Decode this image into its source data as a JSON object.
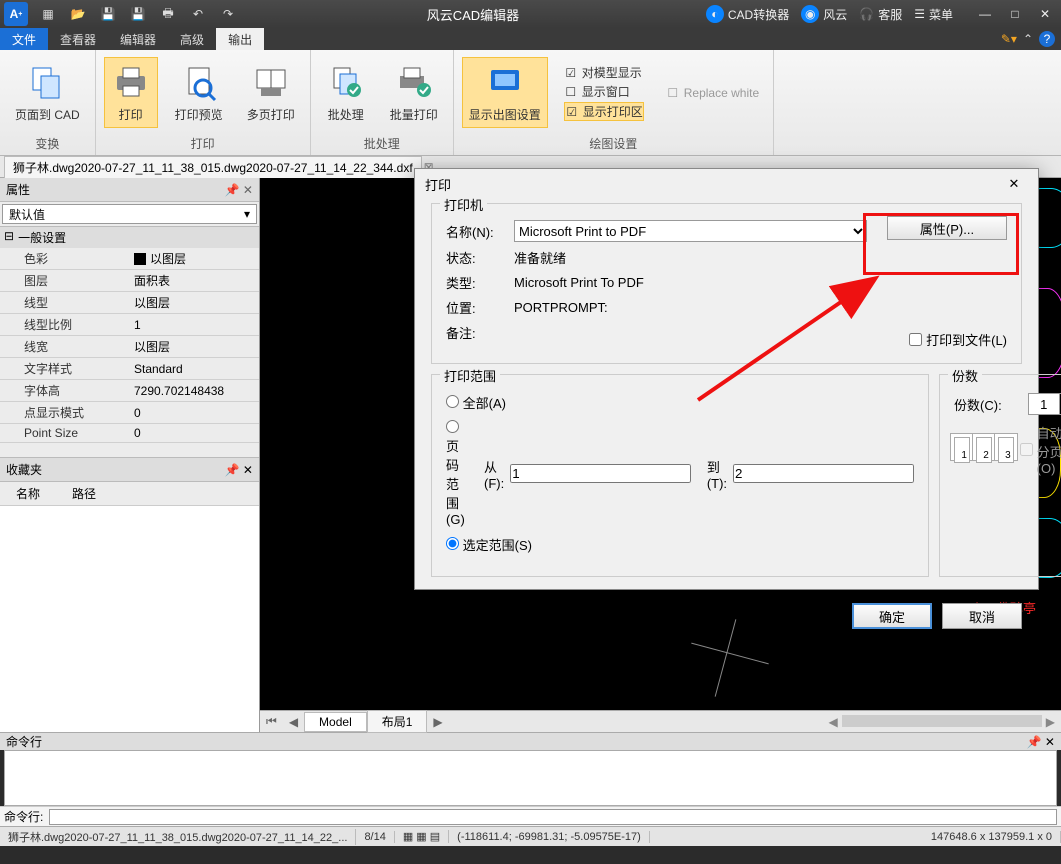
{
  "titlebar": {
    "app_title": "风云CAD编辑器",
    "links": {
      "converter": "CAD转换器",
      "fengyun": "风云",
      "support": "客服",
      "menu": "菜单"
    }
  },
  "menu": {
    "file": "文件",
    "viewer": "查看器",
    "editor": "编辑器",
    "advanced": "高级",
    "output": "输出"
  },
  "ribbon": {
    "convert": {
      "page_to_cad": "页面到 CAD",
      "label": "变换"
    },
    "print_group": {
      "print": "打印",
      "preview": "打印预览",
      "multi": "多页打印",
      "label": "打印"
    },
    "batch_group": {
      "batch": "批处理",
      "batch_print": "批量打印",
      "label": "批处理"
    },
    "plot_group": {
      "show_settings": "显示出图设置",
      "model_display": "对模型显示",
      "replace_white": "Replace white",
      "show_window": "显示窗口",
      "show_print_area": "显示打印区",
      "label": "绘图设置"
    }
  },
  "doc_tab": "狮子林.dwg2020-07-27_11_11_38_015.dwg2020-07-27_11_14_22_344.dxf",
  "props": {
    "panel_title": "属性",
    "combo": "默认值",
    "cat": "一般设置",
    "rows": [
      {
        "k": "色彩",
        "v": "以图层",
        "swatch": true
      },
      {
        "k": "图层",
        "v": "面积表"
      },
      {
        "k": "线型",
        "v": "以图层"
      },
      {
        "k": "线型比例",
        "v": "1"
      },
      {
        "k": "线宽",
        "v": "以图层"
      },
      {
        "k": "文字样式",
        "v": "Standard"
      },
      {
        "k": "字体高",
        "v": "7290.702148438"
      },
      {
        "k": "点显示模式",
        "v": "0"
      },
      {
        "k": "Point Size",
        "v": "0"
      }
    ]
  },
  "fav": {
    "title": "收藏夹",
    "name": "名称",
    "path": "路径"
  },
  "layout": {
    "model": "Model",
    "layout1": "布局1"
  },
  "cmd": {
    "title": "命令行",
    "label": "命令行:"
  },
  "status": {
    "file": "狮子林.dwg2020-07-27_11_11_38_015.dwg2020-07-27_11_14_22_...",
    "page": "8/14",
    "coords": "(-118611.4; -69981.31; -5.09575E-17)",
    "size": "147648.6 x 137959.1 x 0"
  },
  "dialog": {
    "title": "打印",
    "printer": {
      "group": "打印机",
      "name_lbl": "名称(N):",
      "name_val": "Microsoft Print to PDF",
      "status_lbl": "状态:",
      "status_val": "准备就绪",
      "type_lbl": "类型:",
      "type_val": "Microsoft Print To PDF",
      "where_lbl": "位置:",
      "where_val": "PORTPROMPT:",
      "comment_lbl": "备注:",
      "properties_btn": "属性(P)...",
      "print_to_file": "打印到文件(L)"
    },
    "range": {
      "group": "打印范围",
      "all": "全部(A)",
      "pages": "页码范围(G)",
      "from_lbl": "从(F):",
      "from_val": "1",
      "to_lbl": "到(T):",
      "to_val": "2",
      "selection": "选定范围(S)"
    },
    "copies": {
      "group": "份数",
      "count_lbl": "份数(C):",
      "count_val": "1",
      "collate": "自动分页(O)"
    },
    "ok": "确定",
    "cancel": "取消"
  },
  "canvas_redtext": "义天佛碑亭"
}
